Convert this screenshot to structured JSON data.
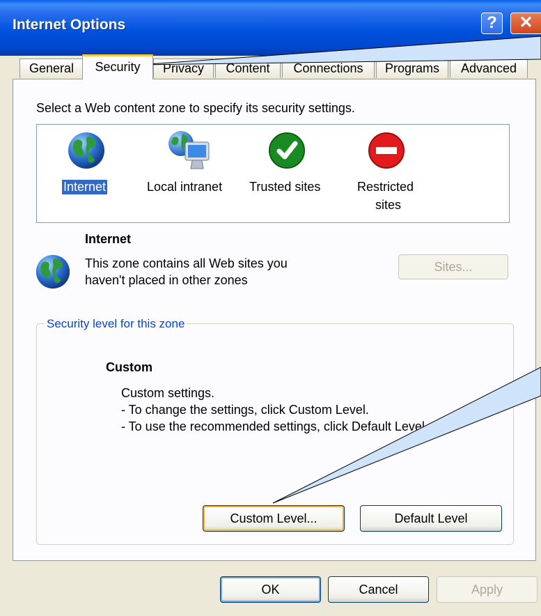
{
  "window": {
    "title": "Internet Options",
    "help_glyph": "?",
    "close_glyph": "✕"
  },
  "tabs": [
    {
      "label": "General",
      "selected": false
    },
    {
      "label": "Security",
      "selected": true
    },
    {
      "label": "Privacy",
      "selected": false
    },
    {
      "label": "Content",
      "selected": false
    },
    {
      "label": "Connections",
      "selected": false
    },
    {
      "label": "Programs",
      "selected": false
    },
    {
      "label": "Advanced",
      "selected": false
    }
  ],
  "security": {
    "instruction": "Select a Web content zone to specify its security settings.",
    "zones": [
      {
        "label": "Internet",
        "icon": "globe-icon",
        "selected": true
      },
      {
        "label": "Local intranet",
        "icon": "intranet-globe-monitor-icon",
        "selected": false
      },
      {
        "label": "Trusted sites",
        "icon": "green-check-icon",
        "selected": false
      },
      {
        "label_line1": "Restricted",
        "label_line2": "sites",
        "icon": "red-stop-icon",
        "selected": false
      }
    ],
    "zone_info": {
      "title": "Internet",
      "desc_line1": "This zone contains all Web sites you",
      "desc_line2": "haven't placed in other zones"
    },
    "sites_button": "Sites...",
    "level_group_label": "Security level for this zone",
    "level": {
      "name": "Custom",
      "line1": "Custom settings.",
      "line2": "- To change the settings, click Custom Level.",
      "line3": "- To use the recommended settings, click Default Level."
    },
    "custom_level_button": "Custom Level...",
    "default_level_button": "Default Level"
  },
  "footer": {
    "ok": "OK",
    "cancel": "Cancel",
    "apply": "Apply"
  },
  "colors": {
    "titlebar": "#0052dd",
    "dialog_bg": "#ece9d8",
    "selected_tab_accent": "#ffc83c",
    "group_label": "#0046d5",
    "selection": "#316ac5",
    "callout_fill": "#cfe3fb"
  }
}
